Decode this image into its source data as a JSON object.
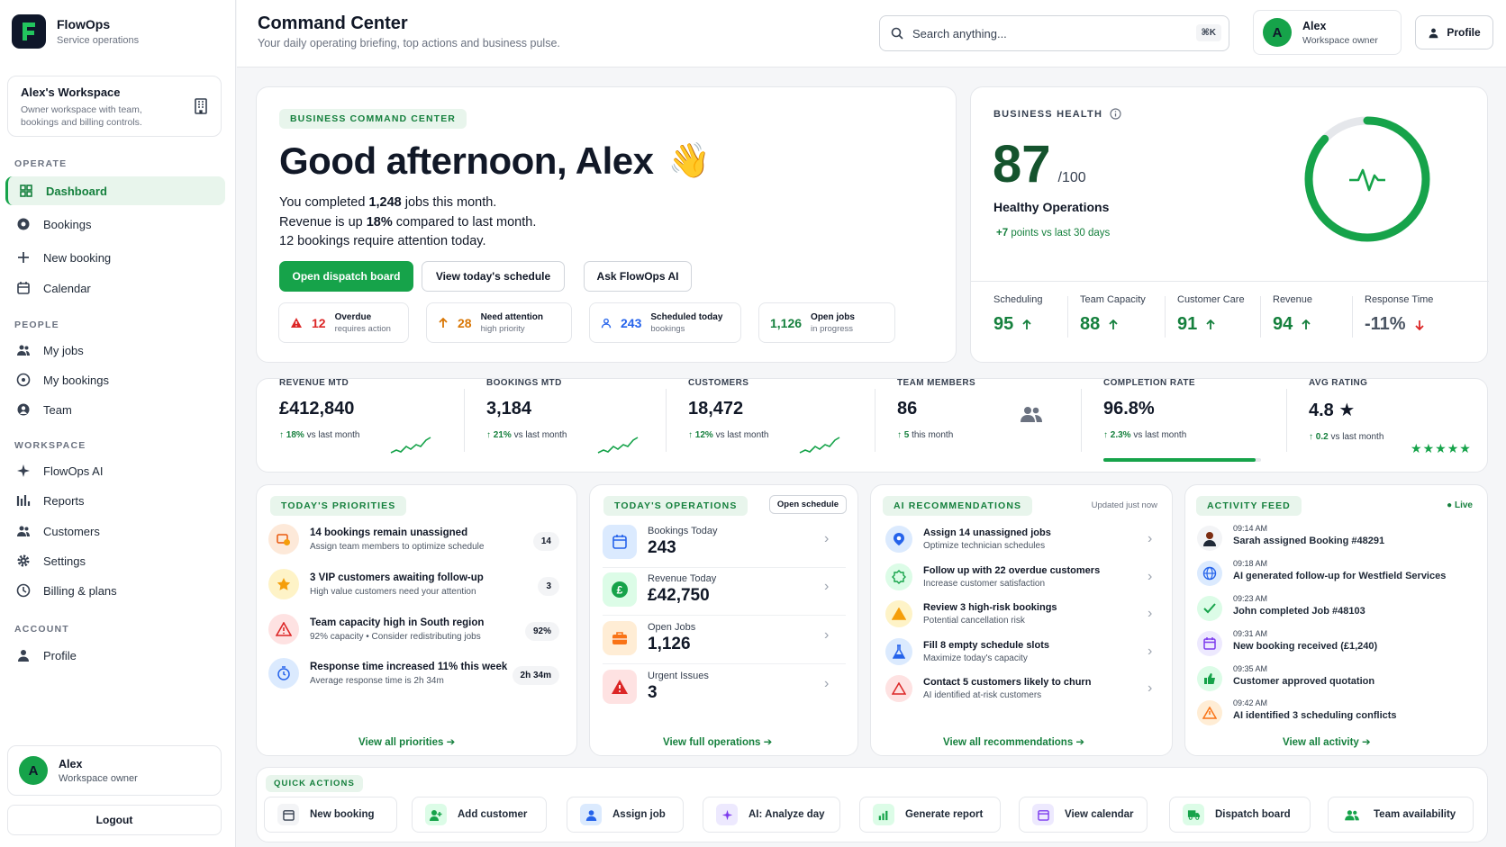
{
  "brand": {
    "name": "FlowOps",
    "subtitle": "Service operations"
  },
  "workspace": {
    "title": "Alex's Workspace",
    "description": "Owner workspace with team, bookings and billing controls."
  },
  "nav": {
    "operate": {
      "label": "OPERATE",
      "items": [
        "Dashboard",
        "Bookings",
        "New booking",
        "Calendar"
      ]
    },
    "people": {
      "label": "PEOPLE",
      "items": [
        "My jobs",
        "My bookings",
        "Team"
      ]
    },
    "workspace": {
      "label": "WORKSPACE",
      "items": [
        "FlowOps AI",
        "Reports",
        "Customers",
        "Settings",
        "Billing & plans"
      ]
    },
    "account": {
      "label": "ACCOUNT",
      "items": [
        "Profile"
      ]
    }
  },
  "user": {
    "initial": "A",
    "name": "Alex",
    "role": "Workspace owner"
  },
  "logout_label": "Logout",
  "header": {
    "title": "Command Center",
    "subtitle": "Your daily operating briefing, top actions and business pulse.",
    "search_placeholder": "Search anything...",
    "shortcut": "⌘K",
    "profile_label": "Profile"
  },
  "hero": {
    "badge": "BUSINESS COMMAND CENTER",
    "greeting": "Good afternoon, Alex",
    "wave": "👋",
    "line1": {
      "pre": "You completed ",
      "val": "1,248",
      "post": " jobs this month."
    },
    "line2": {
      "pre": "Revenue is up ",
      "val": "18%",
      "post": " compared to last month."
    },
    "line3": "12 bookings require attention today.",
    "buttons": [
      "Open dispatch board",
      "View today's schedule",
      "Ask FlowOps AI"
    ],
    "chips": [
      {
        "num": "12",
        "title": "Overdue",
        "sub": "requires action",
        "color": "#dc2626"
      },
      {
        "num": "28",
        "title": "Need attention",
        "sub": "high priority",
        "color": "#d97706"
      },
      {
        "num": "243",
        "title": "Scheduled today",
        "sub": "bookings",
        "color": "#2563eb"
      },
      {
        "num": "1,126",
        "title": "Open jobs",
        "sub": "in progress",
        "color": "#15803d"
      }
    ]
  },
  "health": {
    "label": "BUSINESS HEALTH",
    "score": "87",
    "max": "/100",
    "score_fraction": 0.87,
    "status": "Healthy Operations",
    "trend_val": "+7",
    "trend_text": "points vs last 30 days",
    "metrics": [
      {
        "label": "Scheduling",
        "value": "95",
        "dir": "up"
      },
      {
        "label": "Team Capacity",
        "value": "88",
        "dir": "up"
      },
      {
        "label": "Customer Care",
        "value": "91",
        "dir": "up"
      },
      {
        "label": "Revenue",
        "value": "94",
        "dir": "up"
      },
      {
        "label": "Response Time",
        "value": "-11%",
        "dir": "down"
      }
    ]
  },
  "kpis": [
    {
      "label": "REVENUE MTD",
      "value": "£412,840",
      "delta": "18%",
      "delta_text": "vs last month"
    },
    {
      "label": "BOOKINGS MTD",
      "value": "3,184",
      "delta": "21%",
      "delta_text": "vs last month"
    },
    {
      "label": "CUSTOMERS",
      "value": "18,472",
      "delta": "12%",
      "delta_text": "vs last month"
    },
    {
      "label": "TEAM MEMBERS",
      "value": "86",
      "delta": "5",
      "delta_text": "this month"
    },
    {
      "label": "COMPLETION RATE",
      "value": "96.8%",
      "delta": "2.3%",
      "delta_text": "vs last month",
      "progress": 0.968
    },
    {
      "label": "AVG RATING",
      "value": "4.8",
      "delta": "0.2",
      "delta_text": "vs last month",
      "stars": 5
    }
  ],
  "priorities": {
    "badge": "TODAY'S PRIORITIES",
    "items": [
      {
        "title": "14 bookings remain unassigned",
        "sub": "Assign team members to optimize schedule",
        "badge": "14"
      },
      {
        "title": "3 VIP customers awaiting follow-up",
        "sub": "High value customers need your attention",
        "badge": "3"
      },
      {
        "title": "Team capacity high in South region",
        "sub": "92% capacity • Consider redistributing jobs",
        "badge": "92%"
      },
      {
        "title": "Response time increased 11% this week",
        "sub": "Average response time is 2h 34m",
        "badge": "2h 34m"
      }
    ],
    "link": "View all priorities"
  },
  "operations": {
    "badge": "TODAY'S OPERATIONS",
    "action": "Open schedule",
    "items": [
      {
        "label": "Bookings Today",
        "value": "243"
      },
      {
        "label": "Revenue Today",
        "value": "£42,750"
      },
      {
        "label": "Open Jobs",
        "value": "1,126"
      },
      {
        "label": "Urgent Issues",
        "value": "3"
      }
    ],
    "link": "View full operations"
  },
  "ai": {
    "badge": "AI RECOMMENDATIONS",
    "updated": "Updated just now",
    "items": [
      {
        "title": "Assign 14 unassigned jobs",
        "sub": "Optimize technician schedules"
      },
      {
        "title": "Follow up with 22 overdue customers",
        "sub": "Increase customer satisfaction"
      },
      {
        "title": "Review 3 high-risk bookings",
        "sub": "Potential cancellation risk"
      },
      {
        "title": "Fill 8 empty schedule slots",
        "sub": "Maximize today's capacity"
      },
      {
        "title": "Contact 5 customers likely to churn",
        "sub": "AI identified at-risk customers"
      }
    ],
    "link": "View all recommendations"
  },
  "activity": {
    "badge": "ACTIVITY FEED",
    "live": "Live",
    "items": [
      {
        "time": "09:14 AM",
        "text": "Sarah assigned Booking #48291"
      },
      {
        "time": "09:18 AM",
        "text": "AI generated follow-up for Westfield Services"
      },
      {
        "time": "09:23 AM",
        "text": "John completed Job #48103"
      },
      {
        "time": "09:31 AM",
        "text": "New booking received (£1,240)"
      },
      {
        "time": "09:35 AM",
        "text": "Customer approved quotation"
      },
      {
        "time": "09:42 AM",
        "text": "AI identified 3 scheduling conflicts"
      }
    ],
    "link": "View all activity"
  },
  "quick_actions": {
    "badge": "QUICK ACTIONS",
    "items": [
      "New booking",
      "Add customer",
      "Assign job",
      "AI: Analyze day",
      "Generate report",
      "View calendar",
      "Dispatch board",
      "Team availability"
    ]
  },
  "colors": {
    "accent": "#16a34a",
    "accent_dark": "#15803d",
    "danger": "#dc2626",
    "warning": "#d97706",
    "info": "#2563eb"
  }
}
